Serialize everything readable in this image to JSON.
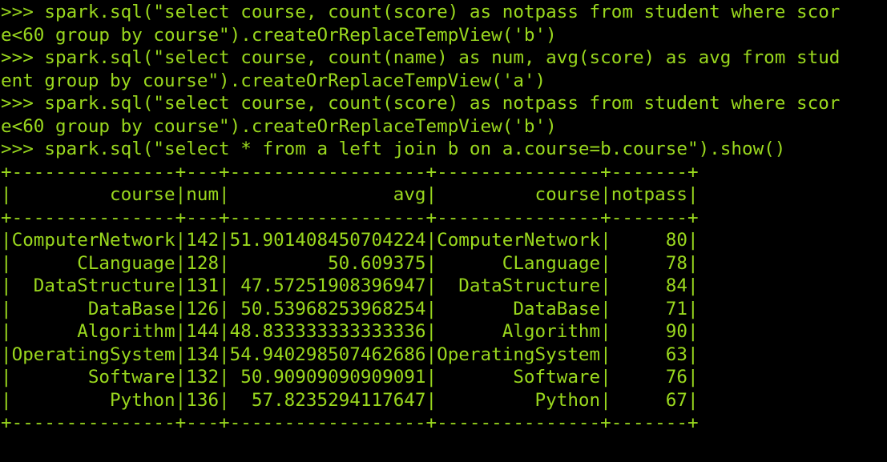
{
  "terminal": {
    "text_color": "#9ad81e",
    "background": "#000000",
    "lines": [
      ">>> spark.sql(\"select course, count(score) as notpass from student where scor",
      "e<60 group by course\").createOrReplaceTempView('b')",
      ">>> spark.sql(\"select course, count(name) as num, avg(score) as avg from stud",
      "ent group by course\").createOrReplaceTempView('a')",
      ">>> spark.sql(\"select course, count(score) as notpass from student where scor",
      "e<60 group by course\").createOrReplaceTempView('b')",
      ">>> spark.sql(\"select * from a left join b on a.course=b.course\").show()",
      "+---------------+---+------------------+---------------+-------+",
      "|         course|num|               avg|         course|notpass|",
      "+---------------+---+------------------+---------------+-------+",
      "|ComputerNetwork|142|51.901408450704224|ComputerNetwork|     80|",
      "|      CLanguage|128|         50.609375|      CLanguage|     78|",
      "|  DataStructure|131| 47.57251908396947|  DataStructure|     84|",
      "|       DataBase|126| 50.53968253968254|       DataBase|     71|",
      "|      Algorithm|144|48.833333333333336|      Algorithm|     90|",
      "|OperatingSystem|134|54.940298507462686|OperatingSystem|     63|",
      "|       Software|132| 50.90909090909091|       Software|     76|",
      "|         Python|136|  57.8235294117647|         Python|     67|",
      "+---------------+---+------------------+---------------+-------+",
      ""
    ],
    "prompt": ">>>"
  }
}
